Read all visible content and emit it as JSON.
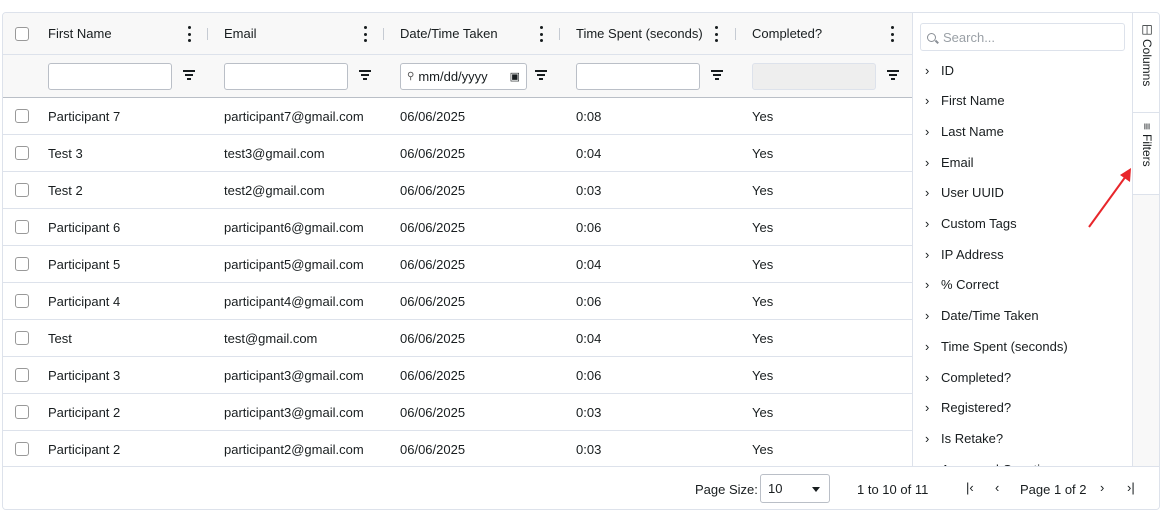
{
  "columns": {
    "first_name": "First Name",
    "email": "Email",
    "date_time": "Date/Time Taken",
    "time_spent": "Time Spent (seconds)",
    "completed": "Completed?"
  },
  "filters": {
    "date_placeholder": "mm/dd/yyyy"
  },
  "rows": [
    {
      "first_name": "Participant 7",
      "email": "participant7@gmail.com",
      "date": "06/06/2025",
      "time": "0:08",
      "completed": "Yes"
    },
    {
      "first_name": "Test 3",
      "email": "test3@gmail.com",
      "date": "06/06/2025",
      "time": "0:04",
      "completed": "Yes"
    },
    {
      "first_name": "Test 2",
      "email": "test2@gmail.com",
      "date": "06/06/2025",
      "time": "0:03",
      "completed": "Yes"
    },
    {
      "first_name": "Participant 6",
      "email": "participant6@gmail.com",
      "date": "06/06/2025",
      "time": "0:06",
      "completed": "Yes"
    },
    {
      "first_name": "Participant 5",
      "email": "participant5@gmail.com",
      "date": "06/06/2025",
      "time": "0:04",
      "completed": "Yes"
    },
    {
      "first_name": "Participant 4",
      "email": "participant4@gmail.com",
      "date": "06/06/2025",
      "time": "0:06",
      "completed": "Yes"
    },
    {
      "first_name": "Test",
      "email": "test@gmail.com",
      "date": "06/06/2025",
      "time": "0:04",
      "completed": "Yes"
    },
    {
      "first_name": "Participant 3",
      "email": "participant3@gmail.com",
      "date": "06/06/2025",
      "time": "0:06",
      "completed": "Yes"
    },
    {
      "first_name": "Participant 2",
      "email": "participant3@gmail.com",
      "date": "06/06/2025",
      "time": "0:03",
      "completed": "Yes"
    },
    {
      "first_name": "Participant 2",
      "email": "participant2@gmail.com",
      "date": "06/06/2025",
      "time": "0:03",
      "completed": "Yes"
    }
  ],
  "side_panel": {
    "search_placeholder": "Search...",
    "items": [
      "ID",
      "First Name",
      "Last Name",
      "Email",
      "User UUID",
      "Custom Tags",
      "IP Address",
      "% Correct",
      "Date/Time Taken",
      "Time Spent (seconds)",
      "Completed?",
      "Registered?",
      "Is Retake?",
      "Answered Questions"
    ],
    "tabs": {
      "columns": "Columns",
      "filters": "Filters"
    }
  },
  "pagination": {
    "page_size_label": "Page Size:",
    "page_size": "10",
    "range": "1 to 10 of 11",
    "page_text": "Page 1 of 2"
  },
  "colors": {
    "annotation_arrow": "#e8262b",
    "border": "#dde2eb",
    "header_bg": "#f8f8f8"
  }
}
